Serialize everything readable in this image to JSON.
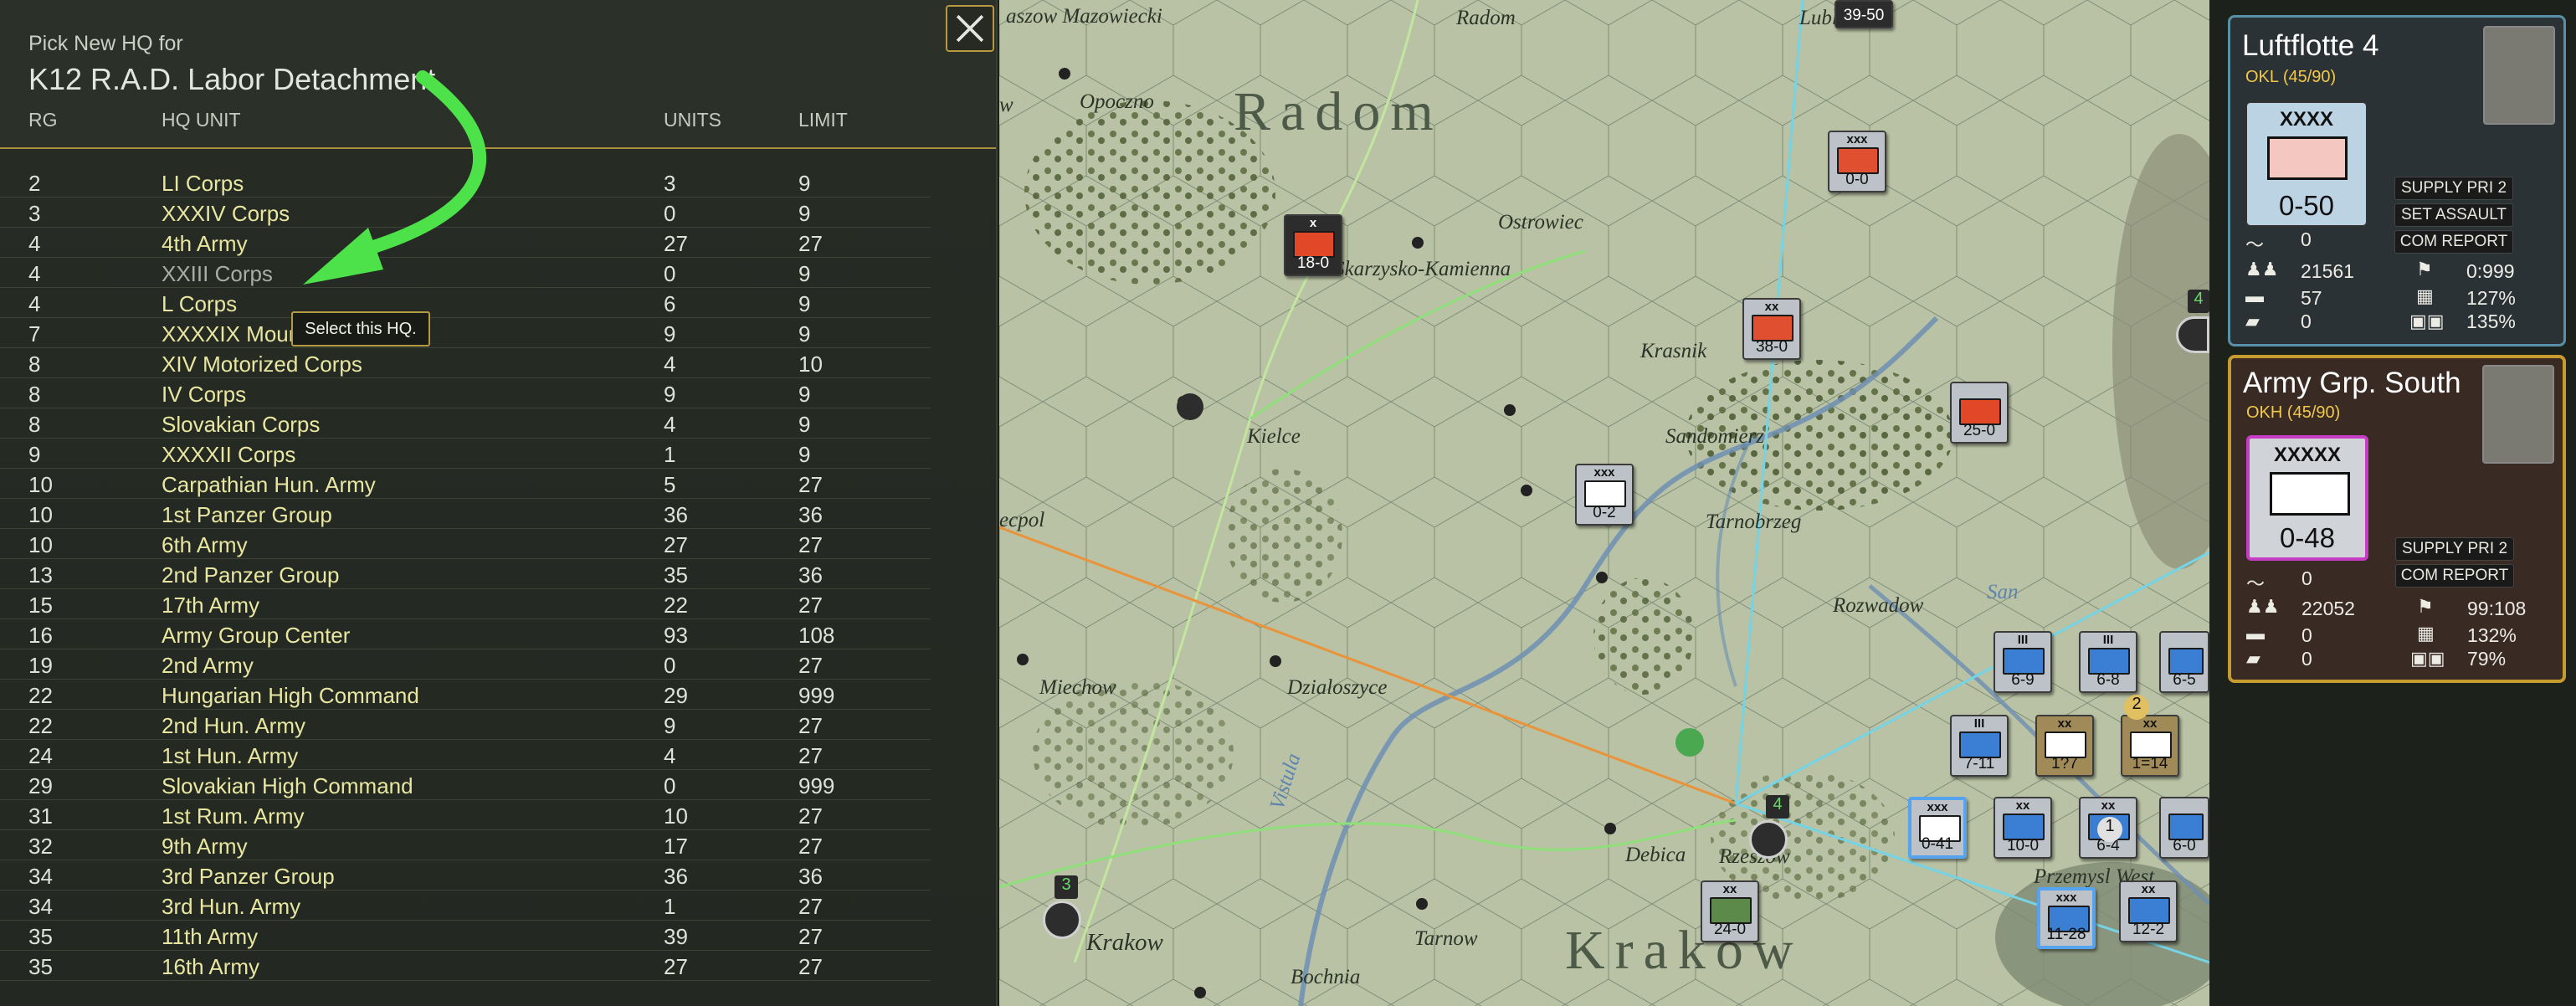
{
  "hq_panel": {
    "pick_label": "Pick New HQ for",
    "unit_title": "K12 R.A.D. Labor Detachment",
    "columns": {
      "rg": "RG",
      "hq_unit": "HQ UNIT",
      "units": "UNITS",
      "limit": "LIMIT"
    },
    "tooltip": "Select this HQ.",
    "close_icon": "close-x-icon",
    "rows": [
      {
        "rg": "2",
        "name": "LI Corps",
        "units": "3",
        "limit": "9"
      },
      {
        "rg": "3",
        "name": "XXXIV Corps",
        "units": "0",
        "limit": "9"
      },
      {
        "rg": "4",
        "name": "4th Army",
        "units": "27",
        "limit": "27"
      },
      {
        "rg": "4",
        "name": "XXIII Corps",
        "units": "0",
        "limit": "9"
      },
      {
        "rg": "4",
        "name": "L Corps",
        "units": "6",
        "limit": "9"
      },
      {
        "rg": "7",
        "name": "XXXXIX Mountain Corps",
        "units": "9",
        "limit": "9"
      },
      {
        "rg": "8",
        "name": "XIV Motorized Corps",
        "units": "4",
        "limit": "10"
      },
      {
        "rg": "8",
        "name": "IV Corps",
        "units": "9",
        "limit": "9"
      },
      {
        "rg": "8",
        "name": "Slovakian Corps",
        "units": "4",
        "limit": "9"
      },
      {
        "rg": "9",
        "name": "XXXXII Corps",
        "units": "1",
        "limit": "9"
      },
      {
        "rg": "10",
        "name": "Carpathian Hun. Army",
        "units": "5",
        "limit": "27"
      },
      {
        "rg": "10",
        "name": "1st Panzer Group",
        "units": "36",
        "limit": "36"
      },
      {
        "rg": "10",
        "name": "6th Army",
        "units": "27",
        "limit": "27"
      },
      {
        "rg": "13",
        "name": "2nd Panzer Group",
        "units": "35",
        "limit": "36"
      },
      {
        "rg": "15",
        "name": "17th Army",
        "units": "22",
        "limit": "27"
      },
      {
        "rg": "16",
        "name": "Army Group Center",
        "units": "93",
        "limit": "108"
      },
      {
        "rg": "19",
        "name": "2nd Army",
        "units": "0",
        "limit": "27"
      },
      {
        "rg": "22",
        "name": "Hungarian High Command",
        "units": "29",
        "limit": "999"
      },
      {
        "rg": "22",
        "name": "2nd Hun. Army",
        "units": "9",
        "limit": "27"
      },
      {
        "rg": "24",
        "name": "1st Hun. Army",
        "units": "4",
        "limit": "27"
      },
      {
        "rg": "29",
        "name": "Slovakian High Command",
        "units": "0",
        "limit": "999"
      },
      {
        "rg": "31",
        "name": "1st Rum. Army",
        "units": "10",
        "limit": "27"
      },
      {
        "rg": "32",
        "name": "9th Army",
        "units": "17",
        "limit": "27"
      },
      {
        "rg": "34",
        "name": "3rd Panzer Group",
        "units": "36",
        "limit": "36"
      },
      {
        "rg": "34",
        "name": "3rd Hun. Army",
        "units": "1",
        "limit": "27"
      },
      {
        "rg": "35",
        "name": "11th Army",
        "units": "39",
        "limit": "27"
      },
      {
        "rg": "35",
        "name": "16th Army",
        "units": "27",
        "limit": "27"
      }
    ]
  },
  "map": {
    "regions": [
      "Radom",
      "Krakow"
    ],
    "places": [
      "aszow Mazowiecki",
      "Radom",
      "Lublin",
      "Opoczno",
      "Ostrowiec",
      "Skarzysko-Kamienna",
      "Krasnik",
      "Kielce",
      "Sandomierz",
      "Tarnobrzeg",
      "ecpol",
      "Rozwadow",
      "San",
      "Miechow",
      "Dzialoszyce",
      "Vistula",
      "Debica",
      "Rzeszow",
      "Przemysl West",
      "Krakow",
      "Tarnow",
      "Bochnia",
      "w"
    ],
    "counters": [
      {
        "size": "",
        "value": "39-50"
      },
      {
        "size": "xxx",
        "value": "0-0"
      },
      {
        "size": "x",
        "value": "18-0"
      },
      {
        "size": "xx",
        "value": "38-0"
      },
      {
        "size": "",
        "value": "25-0"
      },
      {
        "size": "xxx",
        "value": "0-2"
      },
      {
        "size": "III",
        "value": "6-9"
      },
      {
        "size": "III",
        "value": "6-8"
      },
      {
        "size": "",
        "value": "6-5"
      },
      {
        "size": "III",
        "value": "7-11"
      },
      {
        "size": "xx",
        "value": "1?7"
      },
      {
        "size": "xx",
        "value": "1=14"
      },
      {
        "size": "xxx",
        "value": "0-41"
      },
      {
        "size": "xx",
        "value": "10-0"
      },
      {
        "size": "xx",
        "value": "6-4"
      },
      {
        "size": "",
        "value": "6-0"
      },
      {
        "size": "xx",
        "value": "24-0"
      },
      {
        "size": "xxx",
        "value": "11-28"
      },
      {
        "size": "xx",
        "value": "12-2"
      }
    ],
    "stack_badges": [
      "4",
      "3",
      "4",
      "2",
      "1"
    ]
  },
  "hq_cards": [
    {
      "name": "Luftflotte 4",
      "command": "OKL",
      "capacity": "(45/90)",
      "echelon": "XXXX",
      "hq_value": "0-50",
      "buttons": [
        "SUPPLY PRI 2",
        "SET ASSAULT",
        "COM REPORT"
      ],
      "stats": {
        "air": "0",
        "men": "21561",
        "guns": "57",
        "tanks": "0",
        "flag": "0:999",
        "supply": "127%",
        "fuel": "135%"
      },
      "colors": {
        "frame": "#5a8fa8",
        "hq_box": "#bcd3e4"
      }
    },
    {
      "name": "Army Grp. South",
      "command": "OKH",
      "capacity": "(45/90)",
      "echelon": "XXXXX",
      "hq_value": "0-48",
      "buttons": [
        "SUPPLY PRI 2",
        "COM REPORT"
      ],
      "stats": {
        "air": "0",
        "men": "22052",
        "guns": "0",
        "tanks": "0",
        "flag": "99:108",
        "supply": "132%",
        "fuel": "79%"
      },
      "colors": {
        "frame": "#c79b2e",
        "hq_box": "#d0d4d8"
      }
    }
  ]
}
